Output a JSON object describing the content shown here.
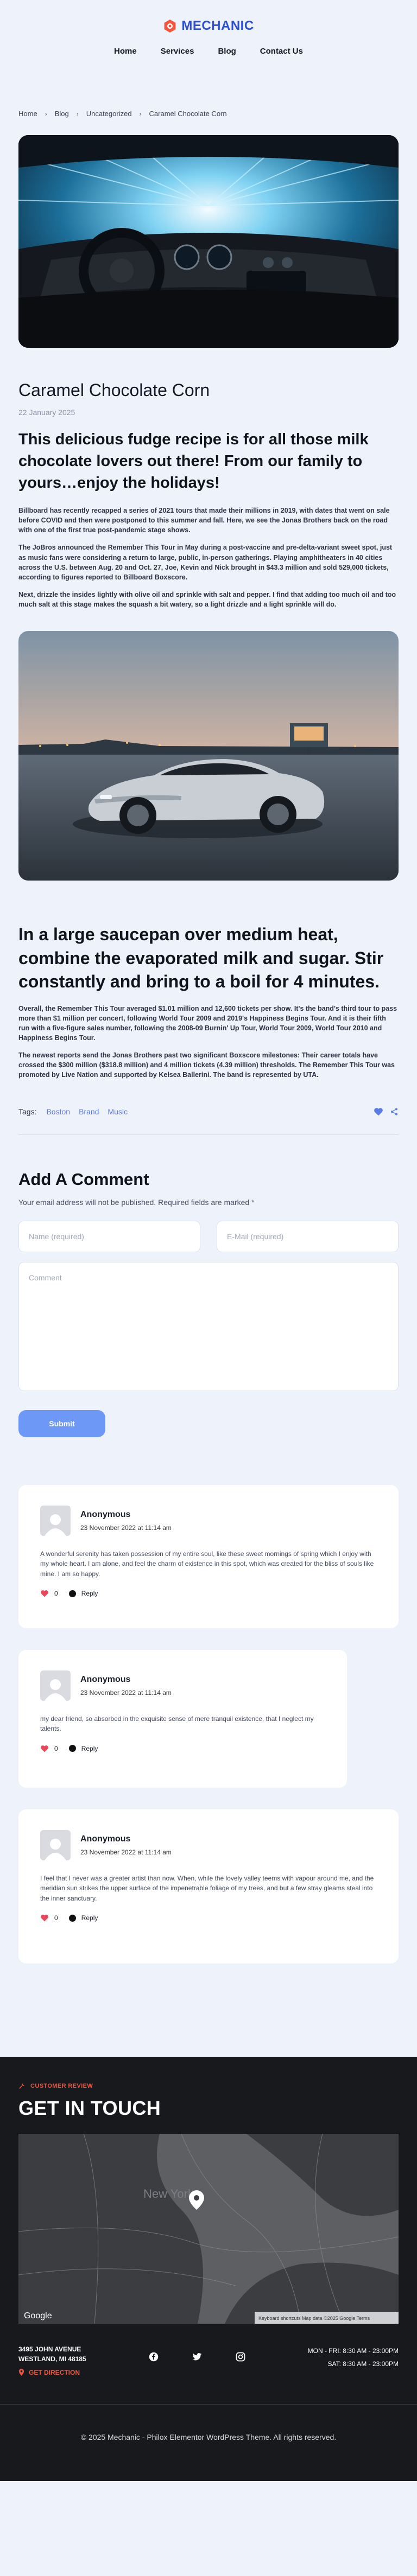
{
  "brand": {
    "name": "MECHANIC",
    "accent": "#2d4fd1",
    "logo_color": "#f2553d"
  },
  "nav": [
    "Home",
    "Services",
    "Blog",
    "Contact Us"
  ],
  "breadcrumb": [
    "Home",
    "Blog",
    "Uncategorized",
    "Caramel Chocolate Corn"
  ],
  "post": {
    "title": "Caramel Chocolate Corn",
    "date": "22 January 2025",
    "lead": "This delicious fudge recipe is for all those milk chocolate lovers out there! From our family to yours…enjoy the holidays!",
    "paragraphs": [
      "Billboard has recently recapped a series of 2021 tours that made their millions in 2019, with dates that went on sale before COVID and then were postponed to this summer and fall. Here, we see the Jonas Brothers back on the road with one of the first true post-pandemic stage shows.",
      "The JoBros announced the Remember This Tour in May during a post-vaccine and pre-delta-variant sweet spot, just as music fans were considering a return to large, public, in-person gatherings. Playing amphitheaters in 40 cities across the U.S. between Aug. 20 and Oct. 27, Joe, Kevin and Nick brought in $43.3 million and sold 529,000 tickets, according to figures reported to Billboard Boxscore.",
      "Next, drizzle the insides lightly with olive oil and sprinkle with salt and pepper. I find that adding too much oil and too much salt at this stage makes the squash a bit watery, so a light drizzle and a light sprinkle will do."
    ],
    "subheading": "In a large saucepan over medium heat, combine the evaporated milk and sugar. Stir constantly and bring to a boil for 4 minutes.",
    "paragraphs2": [
      "Overall, the Remember This Tour averaged $1.01 million and 12,600 tickets per show. It's the band's third tour to pass more than $1 million per concert, following World Tour 2009 and 2019's Happiness Begins Tour. And it is their fifth run with a five-figure sales number, following the 2008-09 Burnin' Up Tour, World Tour 2009, World Tour 2010 and Happiness Begins Tour.",
      "The newest reports send the Jonas Brothers past two significant Boxscore milestones: Their career totals have crossed the $300 million ($318.8 million) and 4 million tickets (4.39 million) thresholds. The Remember This Tour was promoted by Live Nation and supported by Kelsea Ballerini. The band is represented by UTA."
    ],
    "tags_label": "Tags:",
    "tags": [
      "Boston",
      "Brand",
      "Music"
    ]
  },
  "comment_form": {
    "title": "Add A Comment",
    "note": "Your email address will not be published. Required fields are marked *",
    "name_placeholder": "Name (required)",
    "email_placeholder": "E-Mail (required)",
    "comment_placeholder": "Comment",
    "submit": "Submit"
  },
  "comments": [
    {
      "author": "Anonymous",
      "date": "23 November 2022 at 11:14 am",
      "text": "A wonderful serenity has taken possession of my entire soul, like these sweet mornings of spring which I enjoy with my whole heart. I am alone, and feel the charm of existence in this spot, which was created for the bliss of souls like mine. I am so happy.",
      "likes": "0",
      "reply": "Reply"
    },
    {
      "author": "Anonymous",
      "date": "23 November 2022 at 11:14 am",
      "text": "my dear friend, so absorbed in the exquisite sense of mere tranquil existence, that I neglect my talents.",
      "likes": "0",
      "reply": "Reply"
    },
    {
      "author": "Anonymous",
      "date": "23 November 2022 at 11:14 am",
      "text": "I feel that I never was a greater artist than now. When, while the lovely valley teems with vapour around me, and the meridian sun strikes the upper surface of the impenetrable foliage of my trees, and but a few stray gleams steal into the inner sanctuary.",
      "likes": "0",
      "reply": "Reply"
    }
  ],
  "footer": {
    "label": "CUSTOMER REVIEW",
    "title": "GET IN TOUCH",
    "map": {
      "attribution": "Keyboard shortcuts   Map data ©2025 Google   Terms",
      "google": "Google",
      "city": "New York"
    },
    "address": [
      "3495 JOHN AVENUE",
      "WESTLAND, MI 48185"
    ],
    "direction": "GET DIRECTION",
    "hours": [
      "MON - FRI: 8:30 AM - 23:00PM",
      "SAT: 8:30 AM - 23:00PM"
    ],
    "copyright": "© 2025 Mechanic - Philox Elementor WordPress Theme. All rights reserved."
  }
}
